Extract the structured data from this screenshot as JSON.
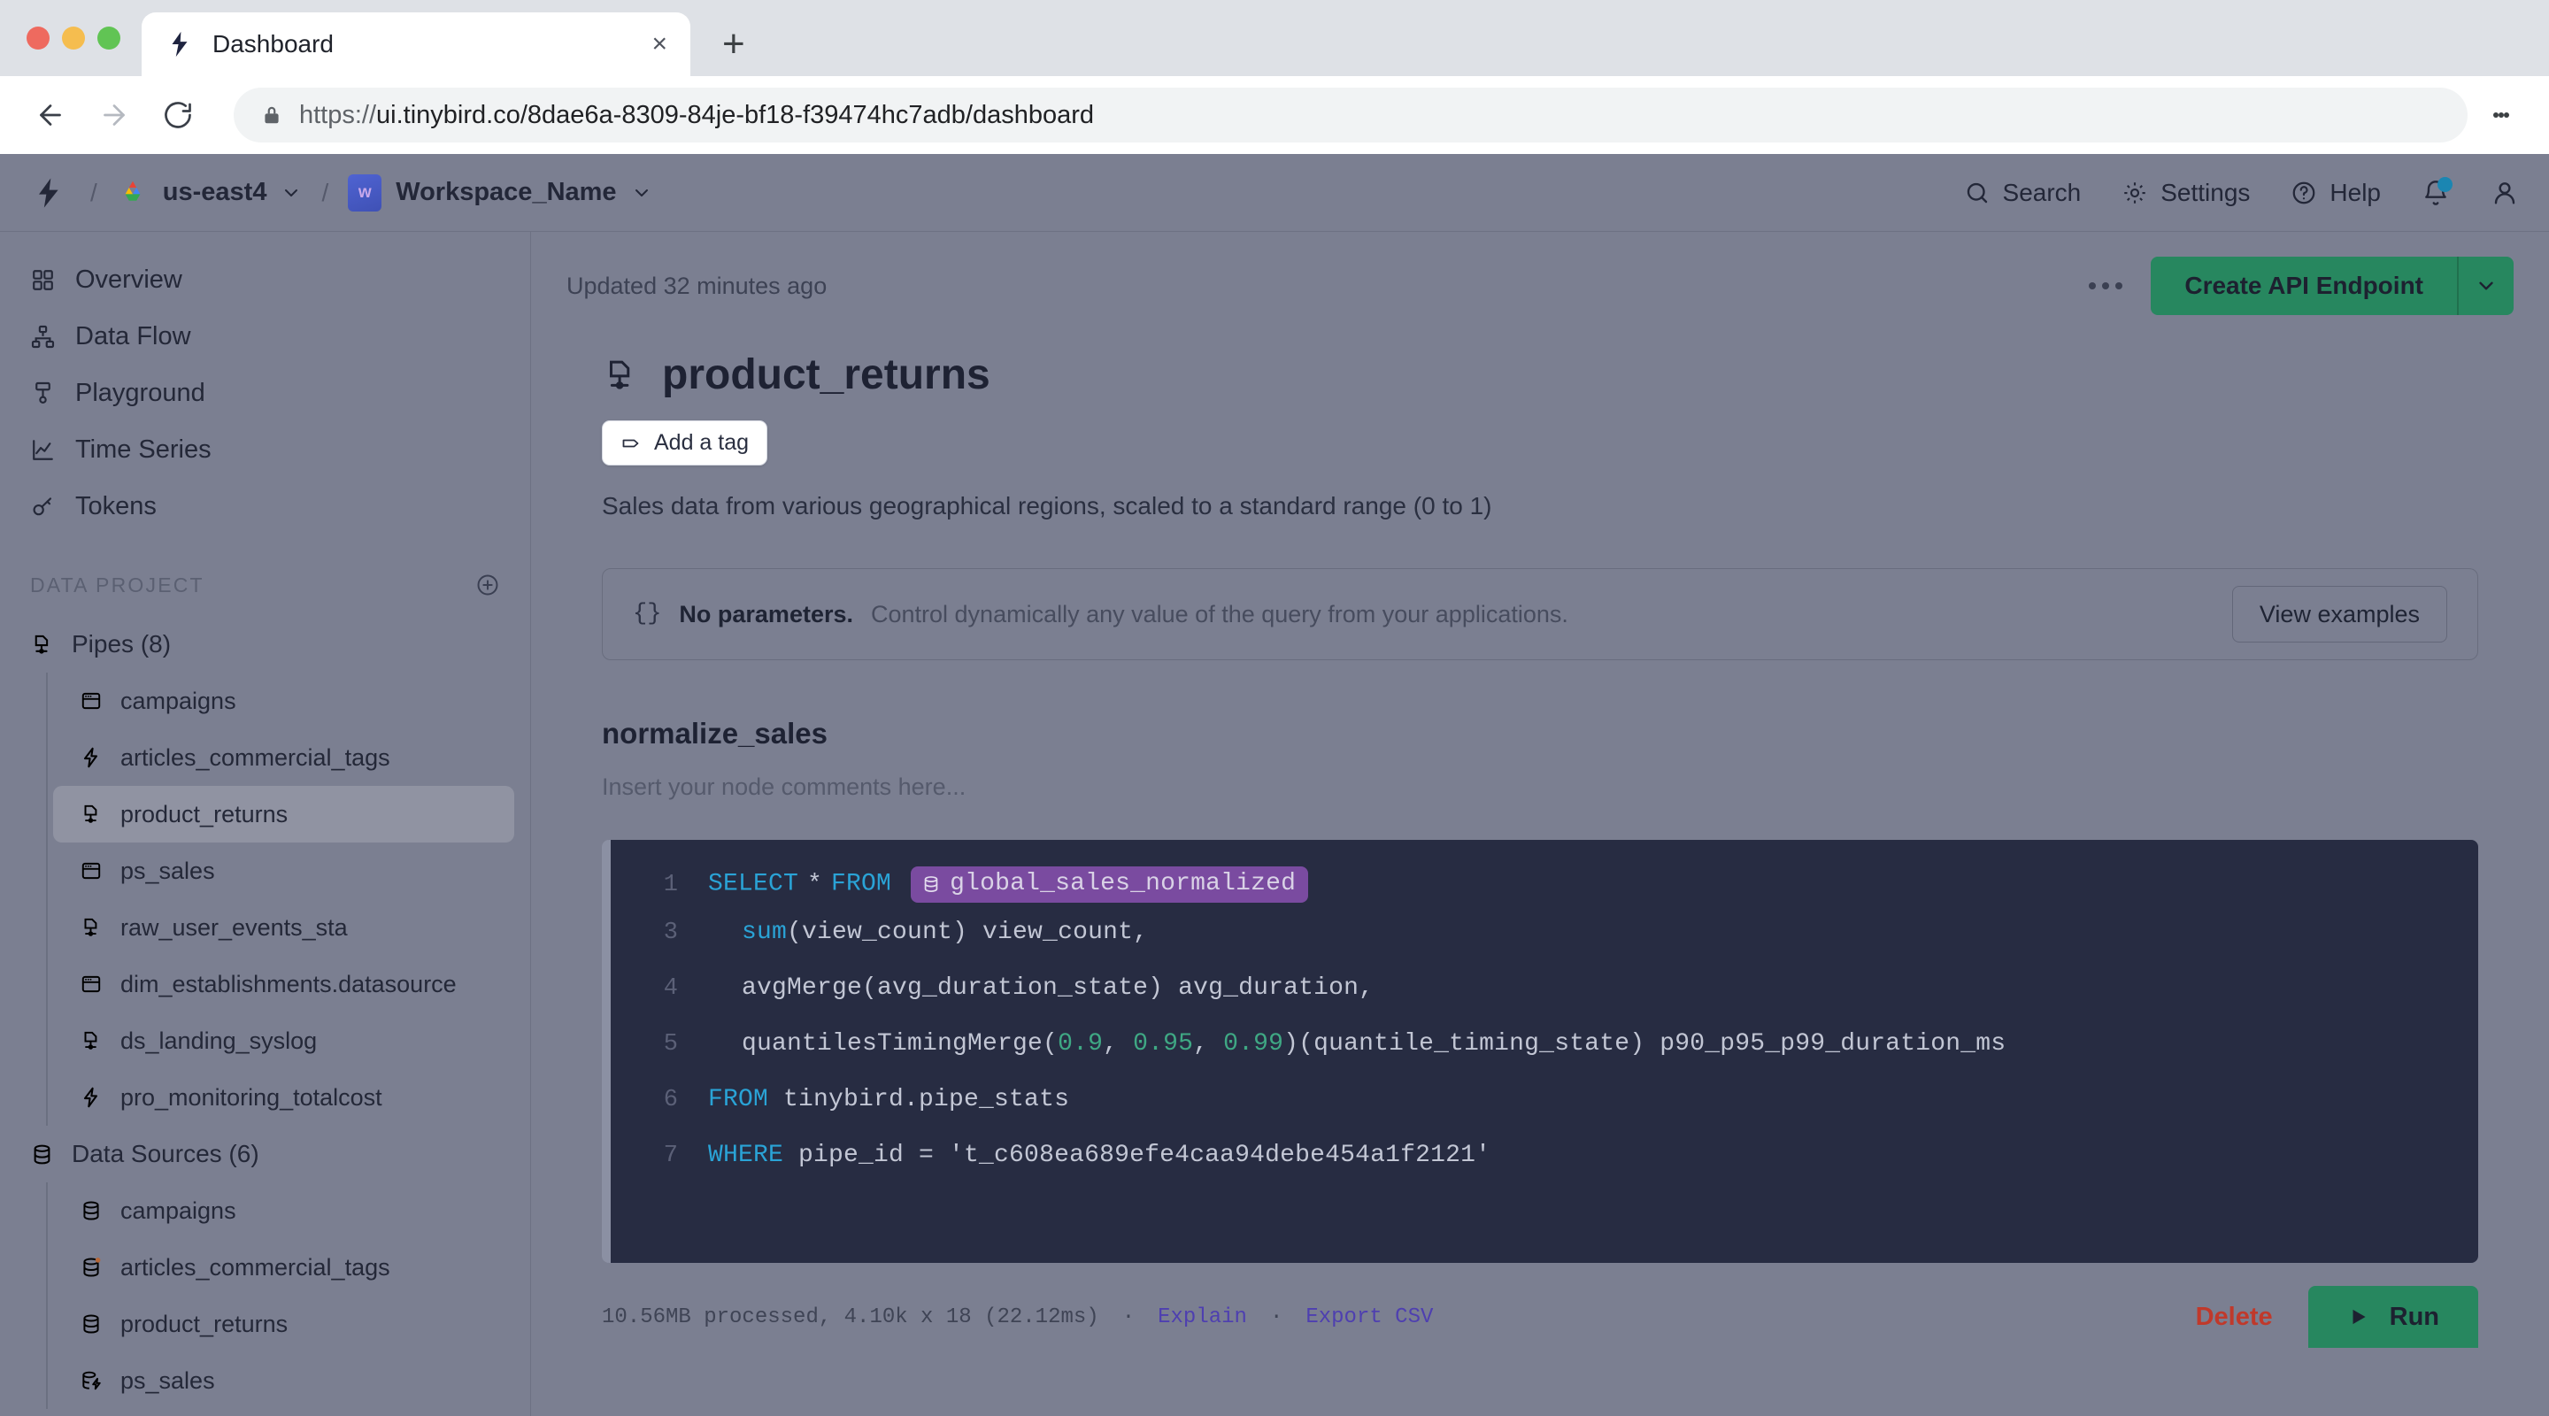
{
  "browser": {
    "tab": {
      "title": "Dashboard",
      "favicon": "tinybird-logo-icon",
      "close": "×"
    },
    "new_tab": "+",
    "nav": {
      "back": "back-icon",
      "forward": "forward-icon",
      "reload": "reload-icon"
    },
    "omnibox": {
      "lock": "lock-icon",
      "scheme": "https://",
      "rest": "ui.tinybird.co/8dae6a-8309-84je-bf18-f39474hc7adb/dashboard"
    }
  },
  "appbar": {
    "logo": "tinybird-logo-icon",
    "separator": "/",
    "region": {
      "label": "us-east4",
      "icon": "gcp-icon"
    },
    "workspace": {
      "badge": "w",
      "label": "Workspace_Name"
    },
    "actions": [
      {
        "label": "Search",
        "icon": "search-icon"
      },
      {
        "label": "Settings",
        "icon": "gear-icon"
      },
      {
        "label": "Help",
        "icon": "help-circle-icon"
      }
    ],
    "notifications_icon": "bell-icon",
    "account_icon": "user-icon"
  },
  "sidebar": {
    "nav": [
      {
        "label": "Overview",
        "icon": "grid-icon"
      },
      {
        "label": "Data Flow",
        "icon": "sitemap-icon"
      },
      {
        "label": "Playground",
        "icon": "playground-icon"
      },
      {
        "label": "Time Series",
        "icon": "chart-line-icon"
      },
      {
        "label": "Tokens",
        "icon": "key-icon"
      }
    ],
    "section_title": "DATA PROJECT",
    "add_icon": "plus-circle-icon",
    "pipes": {
      "label": "Pipes (8)",
      "icon": "pipe-icon",
      "items": [
        {
          "label": "campaigns",
          "icon": "table-icon",
          "active": false
        },
        {
          "label": "articles_commercial_tags",
          "icon": "bolt-icon",
          "active": false
        },
        {
          "label": "product_returns",
          "icon": "pipe-icon",
          "active": true
        },
        {
          "label": "ps_sales",
          "icon": "table-icon",
          "active": false
        },
        {
          "label": "raw_user_events_sta",
          "icon": "pipe-icon",
          "active": false
        },
        {
          "label": "dim_establishments.datasource",
          "icon": "table-icon",
          "active": false
        },
        {
          "label": "ds_landing_syslog",
          "icon": "pipe-icon",
          "active": false
        },
        {
          "label": "pro_monitoring_totalcost",
          "icon": "bolt-icon",
          "active": false
        }
      ]
    },
    "datasources": {
      "label": "Data Sources (6)",
      "icon": "database-icon",
      "items": [
        {
          "label": "campaigns",
          "icon": "database-icon",
          "dot": false
        },
        {
          "label": "articles_commercial_tags",
          "icon": "database-icon",
          "dot": true
        },
        {
          "label": "product_returns",
          "icon": "database-icon",
          "dot": false
        },
        {
          "label": "ps_sales",
          "icon": "database-bolt-icon",
          "dot": false
        }
      ]
    }
  },
  "main": {
    "updated": "Updated 32 minutes ago",
    "kebab": "more-options-icon",
    "create_endpoint": "Create API Endpoint",
    "create_endpoint_caret": "chevron-down-icon",
    "pipe": {
      "icon": "pipe-icon",
      "title": "product_returns",
      "tag_button": "Add a tag",
      "tag_icon": "tag-icon",
      "description": "Sales data from various geographical regions, scaled to a standard range (0 to 1)"
    },
    "parameters": {
      "brace": "{}",
      "strong": "No parameters.",
      "text": "Control dynamically any value of the query from your applications.",
      "button": "View examples"
    },
    "node": {
      "title": "normalize_sales",
      "comment": "Insert your node comments here..."
    },
    "code_lines": [
      {
        "n": "1",
        "type": "select_from_chip",
        "kw1": "SELECT",
        "star": "*",
        "kw2": "FROM",
        "chip_icon": "database-icon",
        "chip": "global_sales_normalized"
      },
      {
        "n": "3",
        "type": "fn_call",
        "indent": "  ",
        "fn": "sum",
        "rest": "(view_count) view_count,"
      },
      {
        "n": "4",
        "type": "plain_indent",
        "text": "  avgMerge(avg_duration_state) avg_duration,"
      },
      {
        "n": "5",
        "type": "quantiles",
        "pre": "  quantilesTimingMerge(",
        "a": "0.9",
        "b": "0.95",
        "c": "0.99",
        "post": ")(quantile_timing_state) p90_p95_p99_duration_ms"
      },
      {
        "n": "6",
        "type": "kw_rest",
        "kw": "FROM",
        "rest": " tinybird.pipe_stats"
      },
      {
        "n": "7",
        "type": "where",
        "kw": "WHERE",
        "mid": " pipe_id = ",
        "str": "'t_c608ea689efe4caa94debe454a1f2121'"
      }
    ],
    "footer": {
      "stats": "10.56MB processed, 4.10k x 18 (22.12ms)",
      "dot": "·",
      "explain": "Explain",
      "export": "Export CSV",
      "delete": "Delete",
      "run": "Run",
      "run_icon": "play-icon"
    }
  }
}
